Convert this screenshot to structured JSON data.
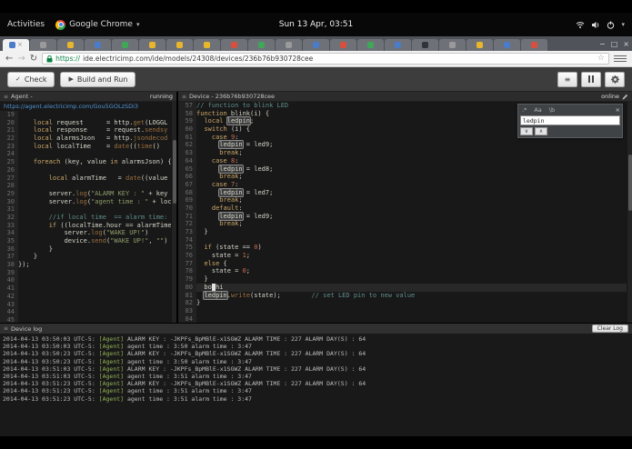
{
  "system_bar": {
    "activities_label": "Activities",
    "app_menu_label": "Google Chrome",
    "menu_caret": "▾",
    "clock": "Sun 13 Apr, 03:51",
    "status_caret": "▾"
  },
  "browser": {
    "tabs": [
      {
        "favicon_color": "#4a7cc9",
        "active": true
      },
      {
        "favicon_color": "#9a9a9a"
      },
      {
        "favicon_color": "#e8b62c"
      },
      {
        "favicon_color": "#4a7cc9"
      },
      {
        "favicon_color": "#3fa757"
      },
      {
        "favicon_color": "#e8b62c"
      },
      {
        "favicon_color": "#e8b62c"
      },
      {
        "favicon_color": "#e8b62c"
      },
      {
        "favicon_color": "#d94f3d"
      },
      {
        "favicon_color": "#3fa757"
      },
      {
        "favicon_color": "#9a9a9a"
      },
      {
        "favicon_color": "#4a7cc9"
      },
      {
        "favicon_color": "#d94f3d"
      },
      {
        "favicon_color": "#3fa757"
      },
      {
        "favicon_color": "#4a7cc9"
      },
      {
        "favicon_color": "#30343a"
      },
      {
        "favicon_color": "#9a9a9a"
      },
      {
        "favicon_color": "#e8b62c"
      },
      {
        "favicon_color": "#4a7cc9"
      },
      {
        "favicon_color": "#d94f3d"
      }
    ],
    "tab_close_glyph": "×",
    "back_glyph": "←",
    "forward_glyph": "→",
    "reload_glyph": "↻",
    "url_protocol": "https://",
    "url_rest": "ide.electricimp.com/ide/models/24308/devices/236b76b930728cee",
    "bookmark_star": "☆",
    "window_controls": [
      "−",
      "□",
      "×"
    ]
  },
  "ide_toolbar": {
    "check_glyph": "✓",
    "check_label": "Check",
    "build_glyph": "▶",
    "build_label": "Build and Run",
    "list_glyph": "≡"
  },
  "agent_pane": {
    "icon_glyph": "≡",
    "title": "Agent - ",
    "url": "https://agent.electricimp.com/Gou5GOLzSDi3",
    "status": "running",
    "code": [
      {
        "n": 19,
        "t": []
      },
      {
        "n": 20,
        "t": [
          [
            "pl",
            "    "
          ],
          [
            "kw",
            "local"
          ],
          [
            "pl",
            " request      = http."
          ],
          [
            "fn",
            "get"
          ],
          [
            "pl",
            "(LOGGL"
          ]
        ]
      },
      {
        "n": 21,
        "t": [
          [
            "pl",
            "    "
          ],
          [
            "kw",
            "local"
          ],
          [
            "pl",
            " response     = request."
          ],
          [
            "fn",
            "sendsy"
          ]
        ]
      },
      {
        "n": 22,
        "t": [
          [
            "pl",
            "    "
          ],
          [
            "kw",
            "local"
          ],
          [
            "pl",
            " alarmsJson   = http."
          ],
          [
            "fn",
            "jsondecod"
          ]
        ]
      },
      {
        "n": 23,
        "t": [
          [
            "pl",
            "    "
          ],
          [
            "kw",
            "local"
          ],
          [
            "pl",
            " localTime    = "
          ],
          [
            "fn",
            "date"
          ],
          [
            "pl",
            "(("
          ],
          [
            "fn",
            "time"
          ],
          [
            "pl",
            "()"
          ]
        ]
      },
      {
        "n": 24,
        "t": []
      },
      {
        "n": 25,
        "t": [
          [
            "pl",
            "    "
          ],
          [
            "kw",
            "foreach"
          ],
          [
            "pl",
            " (key, value "
          ],
          [
            "kw",
            "in"
          ],
          [
            "pl",
            " alarmsJson) {"
          ]
        ]
      },
      {
        "n": 26,
        "t": []
      },
      {
        "n": 27,
        "t": [
          [
            "pl",
            "        "
          ],
          [
            "kw",
            "local"
          ],
          [
            "pl",
            " alarmTime   = "
          ],
          [
            "fn",
            "date"
          ],
          [
            "pl",
            "((value"
          ]
        ]
      },
      {
        "n": 28,
        "t": []
      },
      {
        "n": 29,
        "t": [
          [
            "pl",
            "        server."
          ],
          [
            "fn",
            "log"
          ],
          [
            "pl",
            "("
          ],
          [
            "str",
            "\"ALARM KEY : \""
          ],
          [
            "pl",
            " + key"
          ]
        ]
      },
      {
        "n": 30,
        "t": [
          [
            "pl",
            "        server."
          ],
          [
            "fn",
            "log"
          ],
          [
            "pl",
            "("
          ],
          [
            "str",
            "\"agent time : \""
          ],
          [
            "pl",
            " + loc"
          ]
        ]
      },
      {
        "n": 31,
        "t": []
      },
      {
        "n": 32,
        "t": [
          [
            "com",
            "        //if local time  == alarm time:"
          ]
        ]
      },
      {
        "n": 33,
        "t": [
          [
            "pl",
            "        "
          ],
          [
            "kw",
            "if"
          ],
          [
            "pl",
            " ((localTime.hour == alarmTime"
          ]
        ]
      },
      {
        "n": 34,
        "t": [
          [
            "pl",
            "            server."
          ],
          [
            "fn",
            "log"
          ],
          [
            "pl",
            "("
          ],
          [
            "str",
            "\"WAKE UP!\""
          ],
          [
            "pl",
            ")"
          ]
        ]
      },
      {
        "n": 35,
        "t": [
          [
            "pl",
            "            device."
          ],
          [
            "fn",
            "send"
          ],
          [
            "pl",
            "("
          ],
          [
            "str",
            "\"WAKE UP!\""
          ],
          [
            "pl",
            ", "
          ],
          [
            "str",
            "\"\""
          ],
          [
            "pl",
            ")"
          ]
        ]
      },
      {
        "n": 36,
        "t": [
          [
            "pl",
            "        }"
          ]
        ]
      },
      {
        "n": 37,
        "t": [
          [
            "pl",
            "    }"
          ]
        ]
      },
      {
        "n": 38,
        "t": [
          [
            "pl",
            "});"
          ]
        ]
      },
      {
        "n": 39,
        "t": []
      },
      {
        "n": 40,
        "t": []
      },
      {
        "n": 41,
        "t": []
      },
      {
        "n": 42,
        "t": []
      },
      {
        "n": 43,
        "t": []
      },
      {
        "n": 44,
        "t": []
      },
      {
        "n": 45,
        "t": []
      }
    ]
  },
  "device_pane": {
    "icon_glyph": "≡",
    "title": "Device - 236b76b930728cee",
    "status": "online",
    "active_line": 80,
    "search": {
      "value": "ledpin",
      "options": [
        ".*",
        "Aa",
        "\\b"
      ],
      "option_names": [
        "regex",
        "case-sensitive",
        "whole-word"
      ],
      "close_glyph": "×",
      "next_glyph": "∨",
      "prev_glyph": "∧"
    },
    "code": [
      {
        "n": 57,
        "t": [
          [
            "com",
            "// function to blink LED"
          ]
        ]
      },
      {
        "n": 58,
        "t": [
          [
            "kw",
            "function"
          ],
          [
            "pl",
            " blink(i) {"
          ]
        ]
      },
      {
        "n": 59,
        "t": [
          [
            "pl",
            "  "
          ],
          [
            "kw",
            "local"
          ],
          [
            "pl",
            " "
          ],
          [
            "match",
            "ledpin"
          ],
          [
            "pl",
            ";"
          ]
        ]
      },
      {
        "n": 60,
        "t": [
          [
            "pl",
            "  "
          ],
          [
            "kw",
            "switch"
          ],
          [
            "pl",
            " (i) {"
          ]
        ]
      },
      {
        "n": 61,
        "t": [
          [
            "pl",
            "    "
          ],
          [
            "kw",
            "case"
          ],
          [
            "pl",
            " "
          ],
          [
            "num",
            "9"
          ],
          [
            "pl",
            ":"
          ]
        ]
      },
      {
        "n": 62,
        "t": [
          [
            "pl",
            "      "
          ],
          [
            "match",
            "ledpin"
          ],
          [
            "pl",
            " = led9;"
          ]
        ]
      },
      {
        "n": 63,
        "t": [
          [
            "pl",
            "      "
          ],
          [
            "kw",
            "break"
          ],
          [
            "pl",
            ";"
          ]
        ]
      },
      {
        "n": 64,
        "t": [
          [
            "pl",
            "    "
          ],
          [
            "kw",
            "case"
          ],
          [
            "pl",
            " "
          ],
          [
            "num",
            "8"
          ],
          [
            "pl",
            ":"
          ]
        ]
      },
      {
        "n": 65,
        "t": [
          [
            "pl",
            "      "
          ],
          [
            "match",
            "ledpin"
          ],
          [
            "pl",
            " = led8;"
          ]
        ]
      },
      {
        "n": 66,
        "t": [
          [
            "pl",
            "      "
          ],
          [
            "kw",
            "break"
          ],
          [
            "pl",
            ";"
          ]
        ]
      },
      {
        "n": 67,
        "t": [
          [
            "pl",
            "    "
          ],
          [
            "kw",
            "case"
          ],
          [
            "pl",
            " "
          ],
          [
            "num",
            "7"
          ],
          [
            "pl",
            ":"
          ]
        ]
      },
      {
        "n": 68,
        "t": [
          [
            "pl",
            "      "
          ],
          [
            "match",
            "ledpin"
          ],
          [
            "pl",
            " = led7;"
          ]
        ]
      },
      {
        "n": 69,
        "t": [
          [
            "pl",
            "      "
          ],
          [
            "kw",
            "break"
          ],
          [
            "pl",
            ";"
          ]
        ]
      },
      {
        "n": 70,
        "t": [
          [
            "pl",
            "    "
          ],
          [
            "kw",
            "default"
          ],
          [
            "pl",
            ":"
          ]
        ]
      },
      {
        "n": 71,
        "t": [
          [
            "pl",
            "      "
          ],
          [
            "match",
            "ledpin"
          ],
          [
            "pl",
            " = led9;"
          ]
        ]
      },
      {
        "n": 72,
        "t": [
          [
            "pl",
            "      "
          ],
          [
            "kw",
            "break"
          ],
          [
            "pl",
            ";"
          ]
        ]
      },
      {
        "n": 73,
        "t": [
          [
            "pl",
            "  }"
          ]
        ]
      },
      {
        "n": 74,
        "t": []
      },
      {
        "n": 75,
        "t": [
          [
            "pl",
            "  "
          ],
          [
            "kw",
            "if"
          ],
          [
            "pl",
            " (state == "
          ],
          [
            "num",
            "0"
          ],
          [
            "pl",
            ")"
          ]
        ]
      },
      {
        "n": 76,
        "t": [
          [
            "pl",
            "    state = "
          ],
          [
            "num",
            "1"
          ],
          [
            "pl",
            ";"
          ]
        ]
      },
      {
        "n": 77,
        "t": [
          [
            "pl",
            "  "
          ],
          [
            "kw",
            "else"
          ],
          [
            "pl",
            " {"
          ]
        ]
      },
      {
        "n": 78,
        "t": [
          [
            "pl",
            "    state = "
          ],
          [
            "num",
            "0"
          ],
          [
            "pl",
            ";"
          ]
        ]
      },
      {
        "n": 79,
        "t": [
          [
            "pl",
            "  }"
          ]
        ]
      },
      {
        "n": 80,
        "t": [
          [
            "pl",
            "  bo"
          ],
          [
            "cur",
            " "
          ],
          [
            "pl",
            "hi"
          ]
        ]
      },
      {
        "n": 81,
        "t": [
          [
            "pl",
            "  "
          ],
          [
            "match",
            "ledpin"
          ],
          [
            "pl",
            "."
          ],
          [
            "fn",
            "write"
          ],
          [
            "pl",
            "(state);        "
          ],
          [
            "com",
            "// set LED pin to new value"
          ]
        ]
      },
      {
        "n": 82,
        "t": [
          [
            "pl",
            "}"
          ]
        ]
      },
      {
        "n": 83,
        "t": []
      },
      {
        "n": 84,
        "t": []
      }
    ]
  },
  "log": {
    "icon_glyph": "≡",
    "title": "Device log",
    "clear_label": "Clear Log",
    "entries": [
      {
        "ts": "2014-04-13 03:50:03 UTC-5:",
        "tag": "[Agent]",
        "msg": "ALARM KEY : -JKPFs_BpMBlE-x1SGWZ ALARM TIME : 227 ALARM DAY(S) : 64"
      },
      {
        "ts": "2014-04-13 03:50:03 UTC-5:",
        "tag": "[Agent]",
        "msg": "agent time : 3:50 alarm time : 3:47"
      },
      {
        "ts": "2014-04-13 03:50:23 UTC-5:",
        "tag": "[Agent]",
        "msg": "ALARM KEY : -JKPFs_BpMBlE-x1SGWZ ALARM TIME : 227 ALARM DAY(S) : 64"
      },
      {
        "ts": "2014-04-13 03:50:23 UTC-5:",
        "tag": "[Agent]",
        "msg": "agent time : 3:50 alarm time : 3:47"
      },
      {
        "ts": "2014-04-13 03:51:03 UTC-5:",
        "tag": "[Agent]",
        "msg": "ALARM KEY : -JKPFs_BpMBlE-x1SGWZ ALARM TIME : 227 ALARM DAY(S) : 64"
      },
      {
        "ts": "2014-04-13 03:51:03 UTC-5:",
        "tag": "[Agent]",
        "msg": "agent time : 3:51 alarm time : 3:47"
      },
      {
        "ts": "2014-04-13 03:51:23 UTC-5:",
        "tag": "[Agent]",
        "msg": "ALARM KEY : -JKPFs_BpMBlE-x1SGWZ ALARM TIME : 227 ALARM DAY(S) : 64"
      },
      {
        "ts": "2014-04-13 03:51:23 UTC-5:",
        "tag": "[Agent]",
        "msg": "agent time : 3:51 alarm time : 3:47"
      },
      {
        "ts": "2014-04-13 03:51:23 UTC-5:",
        "tag": "[Agent]",
        "msg": "agent time : 3:51 alarm time : 3:47"
      }
    ]
  }
}
